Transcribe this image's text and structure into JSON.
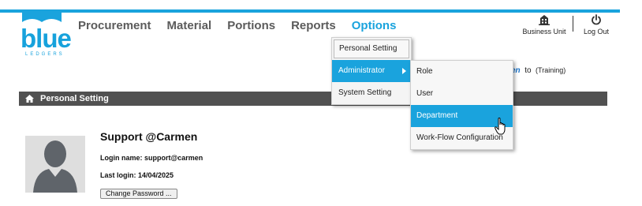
{
  "brand": {
    "logo_text": "blue",
    "logo_subtext": "LEDGERS",
    "accent": "#1aa3dd"
  },
  "nav": {
    "items": [
      "Procurement",
      "Material",
      "Portions",
      "Reports",
      "Options"
    ],
    "active": "Options"
  },
  "header_actions": {
    "business_unit": "Business Unit",
    "logout": "Log Out"
  },
  "environment": {
    "partial_name": "en",
    "to": "to",
    "tag": "(Training)"
  },
  "page": {
    "title": "Personal Setting"
  },
  "profile": {
    "name": "Support @Carmen",
    "login_name": "Login name: support@carmen",
    "last_login": "Last login: 14/04/2025",
    "change_password": "Change Password ..."
  },
  "options_menu": {
    "items": [
      "Personal Setting",
      "Administrator",
      "System Setting"
    ],
    "highlighted": "Administrator"
  },
  "admin_submenu": {
    "items": [
      "Role",
      "User",
      "Department",
      "Work-Flow Configuration"
    ],
    "highlighted": "Department"
  },
  "icons": {
    "home": "home-icon",
    "business_unit": "building-icon",
    "logout": "power-icon",
    "submenu": "chevron-right-icon",
    "cursor": "hand-pointer-icon",
    "avatar": "user-silhouette-icon"
  }
}
